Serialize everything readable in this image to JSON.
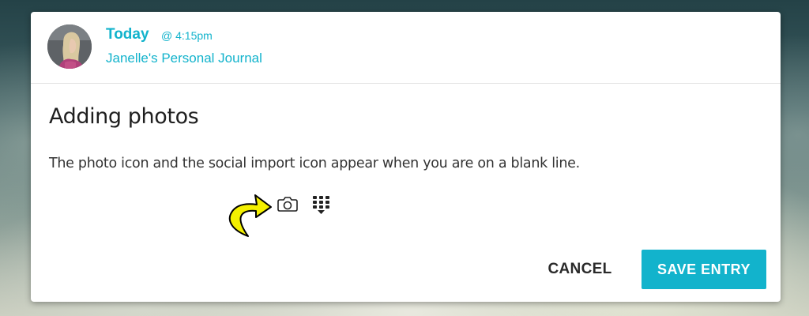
{
  "entry": {
    "day": "Today",
    "time": "@ 4:15pm",
    "journal_name": "Janelle's Personal Journal",
    "title": "Adding photos",
    "body": "The photo icon and the social import icon appear when you are on a blank line."
  },
  "editor_icons": {
    "photo": "camera-icon",
    "social_import": "grid-import-icon",
    "annotation": "curved-arrow"
  },
  "actions": {
    "cancel_label": "CANCEL",
    "save_label": "SAVE ENTRY"
  },
  "colors": {
    "accent": "#12b3cc",
    "annotation_arrow": "#f4f000"
  }
}
